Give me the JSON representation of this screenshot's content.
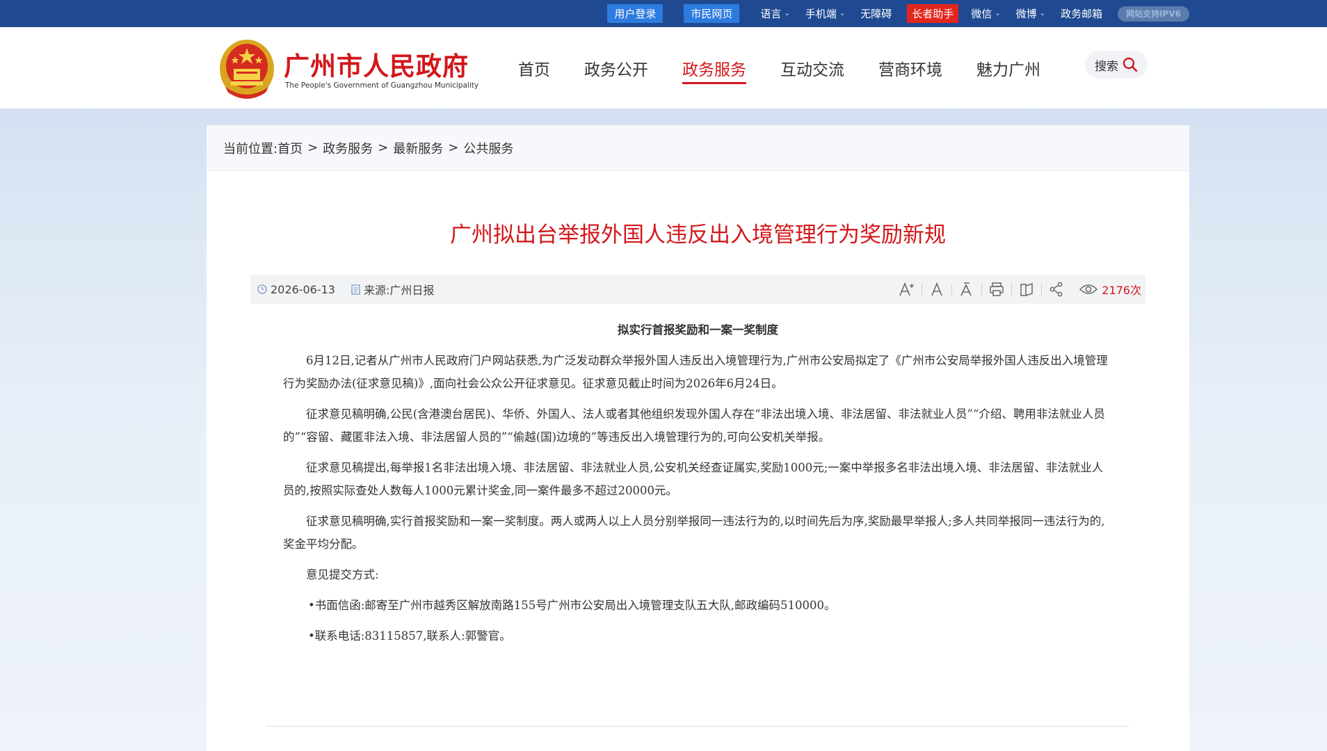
{
  "topbar": {
    "login": "用户登录",
    "citizen": "市民网页",
    "language": "语言",
    "mobile": "手机端",
    "accessibility": "无障碍",
    "elder": "长者助手",
    "wechat": "微信",
    "weibo": "微博",
    "mail": "政务邮箱",
    "ipv6": "网站支持IPV6"
  },
  "header": {
    "brand_cn": "广州市人民政府",
    "brand_en": "The People's Government of Guangzhou Municipality",
    "nav": [
      "首页",
      "政务公开",
      "政务服务",
      "互动交流",
      "营商环境",
      "魅力广州"
    ],
    "search": "搜索"
  },
  "breadcrumb": {
    "label": "当前位置:",
    "items": [
      "首页",
      "政务服务",
      "最新服务",
      "公共服务"
    ],
    "sep": ">"
  },
  "article": {
    "title": "广州拟出台举报外国人违反出入境管理行为奖励新规",
    "date": "2026-06-13",
    "source": "来源:广州日报",
    "views": "2176次",
    "subhead": "拟实行首报奖励和一案一奖制度",
    "paragraphs": [
      "6月12日,记者从广州市人民政府门户网站获悉,为广泛发动群众举报外国人违反出入境管理行为,广州市公安局拟定了《广州市公安局举报外国人违反出入境管理行为奖励办法(征求意见稿)》,面向社会公众公开征求意见。征求意见截止时间为2026年6月24日。",
      "征求意见稿明确,公民(含港澳台居民)、华侨、外国人、法人或者其他组织发现外国人存在“非法出境入境、非法居留、非法就业人员”“介绍、聘用非法就业人员的”“容留、藏匿非法入境、非法居留人员的”“偷越(国)边境的”等违反出入境管理行为的,可向公安机关举报。",
      "征求意见稿提出,每举报1名非法出境入境、非法居留、非法就业人员,公安机关经查证属实,奖励1000元;一案中举报多名非法出境入境、非法居留、非法就业人员的,按照实际查处人数每人1000元累计奖金,同一案件最多不超过20000元。",
      "征求意见稿明确,实行首报奖励和一案一奖制度。两人或两人以上人员分别举报同一违法行为的,以时间先后为序,奖励最早举报人;多人共同举报同一违法行为的,奖金平均分配。",
      "意见提交方式:"
    ],
    "bullets": [
      "•书面信函:邮寄至广州市越秀区解放南路155号广州市公安局出入境管理支队五大队,邮政编码510000。",
      "•联系电话:83115857,联系人:郭警官。"
    ]
  },
  "colors": {
    "topbar": "#1f4a92",
    "accent_red": "#d2171b",
    "button_blue": "#2d7be0"
  }
}
